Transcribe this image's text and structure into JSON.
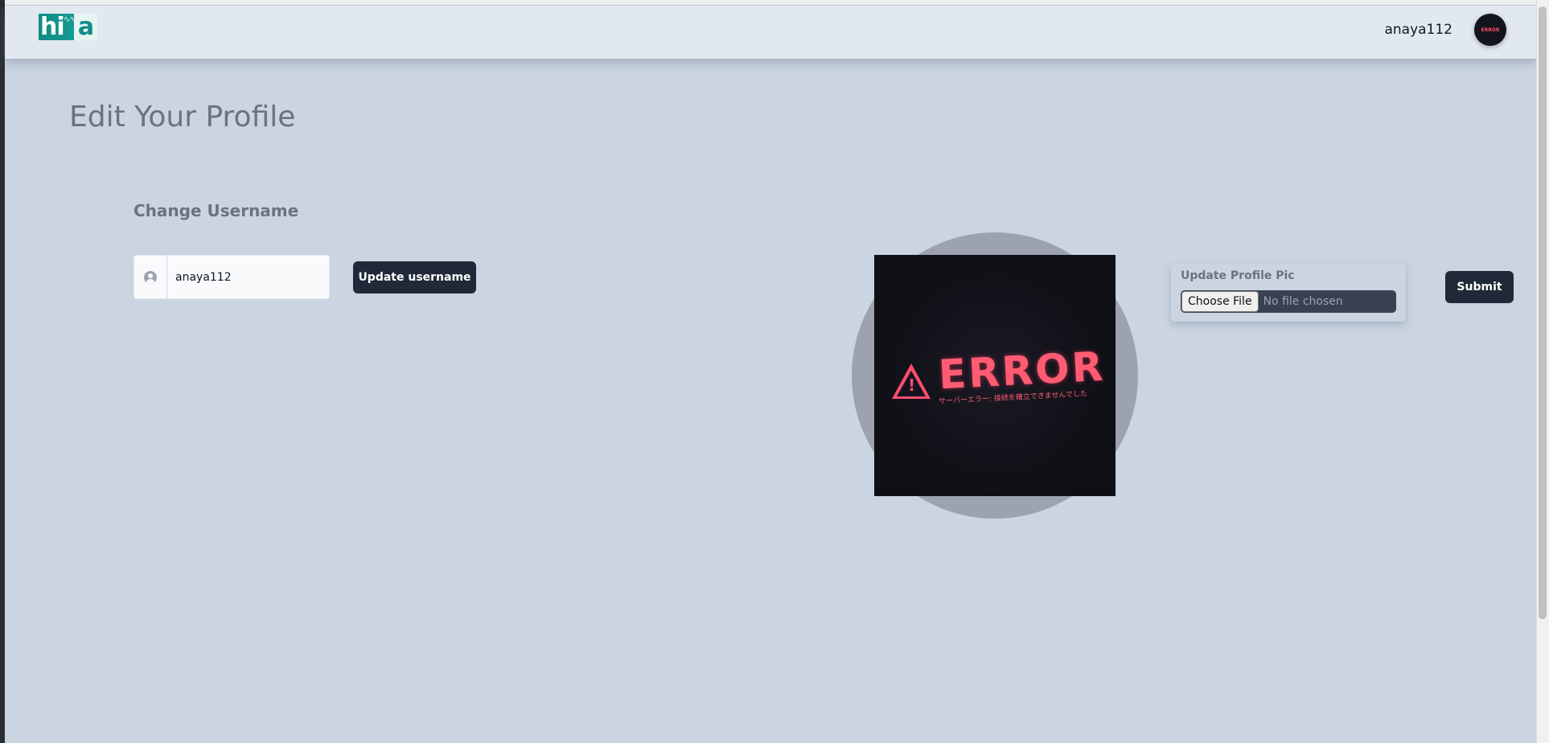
{
  "navbar": {
    "logo_text": "hi",
    "logo_letter": "a",
    "username": "anaya112",
    "avatar_text": "ERROR"
  },
  "page": {
    "title": "Edit Your Profile"
  },
  "username_section": {
    "title": "Change Username",
    "input_value": "anaya112",
    "button_label": "Update username"
  },
  "profile_pic": {
    "image_headline": "ERROR",
    "image_subtext": "サーバーエラー: 接続を確立できませんでした",
    "upload_label": "Update Profile Pic",
    "choose_file_label": "Choose File",
    "no_file_text": "No file chosen",
    "submit_label": "Submit"
  },
  "colors": {
    "background": "#cbd5e1",
    "navbar": "#e2e8f0",
    "button_dark": "#1f2937",
    "logo_teal": "#0f8d86",
    "error_red": "#ff5c74"
  },
  "icons": {
    "addon": "user-circle-icon",
    "warning": "warning-triangle-icon"
  }
}
